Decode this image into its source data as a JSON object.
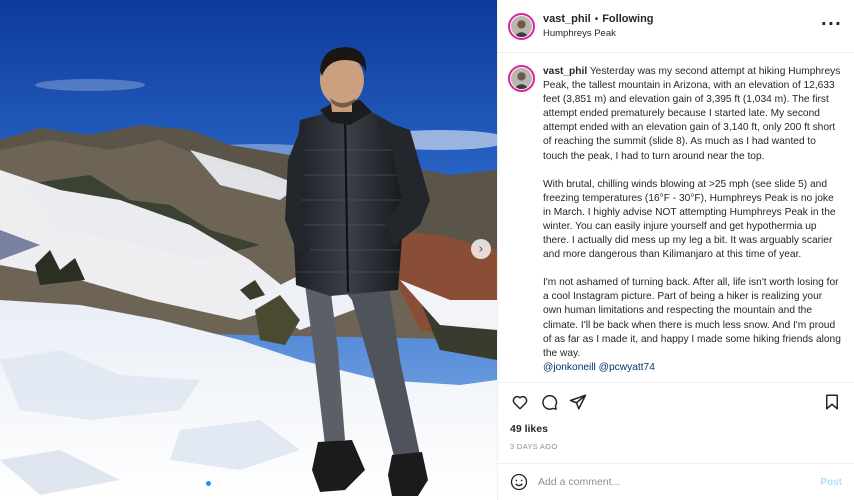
{
  "header": {
    "username": "vast_phil",
    "separator": "•",
    "follow_state": "Following",
    "location": "Humphreys Peak",
    "more_icon": "more-horizontal-icon"
  },
  "caption": {
    "username": "vast_phil",
    "paragraphs": [
      "Yesterday was my second attempt at hiking Humphreys Peak, the tallest mountain in Arizona, with an elevation of 12,633 feet (3,851 m) and elevation gain of 3,395 ft (1,034 m). The first attempt ended prematurely because I started late. My second attempt ended with an elevation gain of 3,140 ft, only 200 ft short of reaching the summit (slide 8). As much as I had wanted to touch the peak, I had to turn around near the top.",
      "With brutal, chilling winds blowing at >25 mph (see slide 5) and freezing temperatures (16°F - 30°F), Humphreys Peak is no joke in March. I highly advise NOT attempting Humphreys Peak in the winter. You can easily injure yourself and get hypothermia up there. I actually did mess up my leg a bit. It was arguably scarier and more dangerous than Kilimanjaro at this time of year.",
      "I'm not ashamed of turning back. After all, life isn't worth losing for a cool Instagram picture. Part of being a hiker is realizing your own human limitations and respecting the mountain and the climate. I'll be back when there is much less snow. And I'm proud of as far as I made it, and happy I made some hiking friends along the way."
    ],
    "mentions": [
      "@jonkoneill",
      "@pcwyatt74"
    ],
    "trailing_dots": [
      ".",
      ".",
      "."
    ]
  },
  "actions": {
    "like_icon": "heart-icon",
    "comment_icon": "comment-icon",
    "share_icon": "send-icon",
    "save_icon": "bookmark-icon"
  },
  "likes": "49 likes",
  "posted": "3 DAYS AGO",
  "comment": {
    "emoji_icon": "smiley-icon",
    "placeholder": "Add a comment...",
    "value": "",
    "post_label": "Post"
  },
  "carousel": {
    "slide_count": 10,
    "active_index": 0,
    "next_icon": "chevron-right-icon"
  },
  "colors": {
    "accent": "#0095f6",
    "post_disabled": "#b2dffc",
    "mention": "#00376b",
    "avatar_ring": "#d6249f",
    "carousel_active_dot": "#1e90ff"
  }
}
